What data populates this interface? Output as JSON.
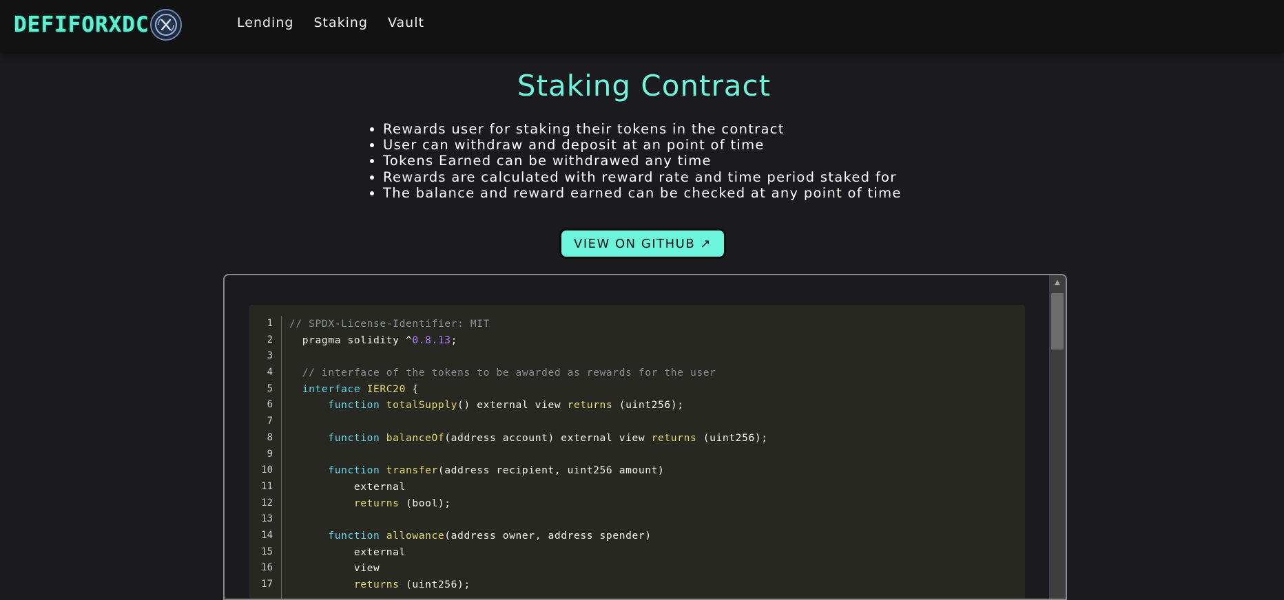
{
  "nav": {
    "logo_text": "DEFIFORXDC",
    "links": [
      "Lending",
      "Staking",
      "Vault"
    ]
  },
  "page": {
    "title": "Staking Contract",
    "features": [
      "Rewards user for staking their tokens in the contract",
      "User can withdraw and deposit at an point of time",
      "Tokens Earned can be withdrawed any time",
      "Rewards are calculated with reward rate and time period staked for",
      "The balance and reward earned can be checked at any point of time"
    ],
    "github_button": "VIEW ON GITHUB ↗"
  },
  "code": {
    "line_numbers": [
      "1",
      "2",
      "3",
      "4",
      "5",
      "6",
      "7",
      "8",
      "9",
      "10",
      "11",
      "12",
      "13",
      "14",
      "15",
      "16",
      "17"
    ],
    "lines": [
      [
        {
          "cls": "c",
          "text": "// SPDX-License-Identifier: MIT"
        }
      ],
      [
        {
          "cls": "t",
          "text": "  pragma solidity ^"
        },
        {
          "cls": "n",
          "text": "0.8.13"
        },
        {
          "cls": "t",
          "text": ";"
        }
      ],
      [
        {
          "cls": "t",
          "text": ""
        }
      ],
      [
        {
          "cls": "c",
          "text": "  // interface of the tokens to be awarded as rewards for the user"
        }
      ],
      [
        {
          "cls": "k",
          "text": "  interface "
        },
        {
          "cls": "f",
          "text": "IERC20"
        },
        {
          "cls": "t",
          "text": " {"
        }
      ],
      [
        {
          "cls": "k",
          "text": "      function "
        },
        {
          "cls": "f",
          "text": "totalSupply"
        },
        {
          "cls": "t",
          "text": "() external view "
        },
        {
          "cls": "r",
          "text": "returns"
        },
        {
          "cls": "t",
          "text": " (uint256);"
        }
      ],
      [
        {
          "cls": "t",
          "text": ""
        }
      ],
      [
        {
          "cls": "k",
          "text": "      function "
        },
        {
          "cls": "f",
          "text": "balanceOf"
        },
        {
          "cls": "t",
          "text": "(address account) external view "
        },
        {
          "cls": "r",
          "text": "returns"
        },
        {
          "cls": "t",
          "text": " (uint256);"
        }
      ],
      [
        {
          "cls": "t",
          "text": ""
        }
      ],
      [
        {
          "cls": "k",
          "text": "      function "
        },
        {
          "cls": "f",
          "text": "transfer"
        },
        {
          "cls": "t",
          "text": "(address recipient, uint256 amount)"
        }
      ],
      [
        {
          "cls": "t",
          "text": "          external"
        }
      ],
      [
        {
          "cls": "r",
          "text": "          returns"
        },
        {
          "cls": "t",
          "text": " (bool);"
        }
      ],
      [
        {
          "cls": "t",
          "text": ""
        }
      ],
      [
        {
          "cls": "k",
          "text": "      function "
        },
        {
          "cls": "f",
          "text": "allowance"
        },
        {
          "cls": "t",
          "text": "(address owner, address spender)"
        }
      ],
      [
        {
          "cls": "t",
          "text": "          external"
        }
      ],
      [
        {
          "cls": "t",
          "text": "          view"
        }
      ],
      [
        {
          "cls": "r",
          "text": "          returns"
        },
        {
          "cls": "t",
          "text": " (uint256);"
        }
      ]
    ]
  },
  "colors": {
    "accent": "#6ff5dc",
    "background": "#1b1b1f",
    "navbar": "#121212",
    "code_bg": "#272822"
  },
  "icons": {
    "logo_badge": "xdc-coin-icon",
    "scroll_up": "scroll-up-arrow-icon"
  }
}
